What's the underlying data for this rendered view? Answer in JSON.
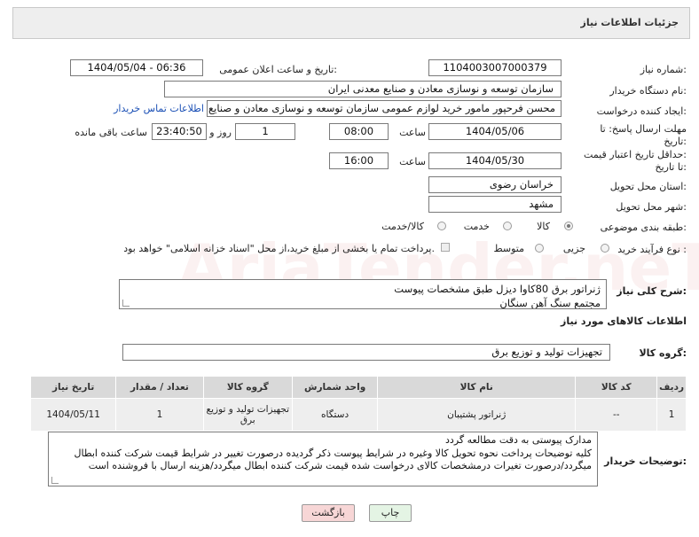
{
  "header": {
    "title": "جزئیات اطلاعات نیاز"
  },
  "watermark": "AriaTender.neT",
  "form": {
    "need_number_label": "شماره نیاز:",
    "need_number": "1104003007000379",
    "announce_label": "تاریخ و ساعت اعلان عمومی:",
    "announce_value": "1404/05/04 - 06:36",
    "buyer_org_label": "نام دستگاه خریدار:",
    "buyer_org": "سازمان توسعه و نوسازی معادن و صنایع معدنی ایران",
    "creator_label": "ایجاد کننده درخواست:",
    "creator": "محسن فرحپور مامور خرید لوازم عمومی سازمان توسعه و نوسازی معادن و صنایع معدنی ایران",
    "contact_link": "اطلاعات تماس خریدار",
    "deadline_label_1": "مهلت ارسال پاسخ: تا",
    "deadline_label_2": "تاریخ:",
    "deadline_date": "1404/05/06",
    "time_label": "ساعت",
    "deadline_time": "08:00",
    "days_value": "1",
    "days_label": "روز و",
    "remaining_time": "23:40:50",
    "remaining_label": "ساعت باقی مانده",
    "price_validity_label_1": "حداقل تاریخ اعتبار قیمت:",
    "price_validity_label_2": "تا تاریخ:",
    "price_validity_date": "1404/05/30",
    "price_validity_time": "16:00",
    "province_label": "استان محل تحویل:",
    "province": "خراسان رضوی",
    "city_label": "شهر محل تحویل:",
    "city": "مشهد",
    "category_label": "طبقه بندی موضوعی:",
    "category_options": [
      "کالا",
      "خدمت",
      "کالا/خدمت"
    ],
    "purchase_type_label": "نوع فرآیند خرید :",
    "purchase_options": [
      "جزیی",
      "متوسط"
    ],
    "payment_note": "پرداخت تمام یا بخشی از مبلغ خرید،از محل \"اسناد خزانه اسلامی\" خواهد بود."
  },
  "description": {
    "label": "شرح کلی نیاز:",
    "line1": "ژنراتور برق 80کاوا دیزل طبق مشخصات پیوست",
    "line2": "مجتمع سنگ آهن سنگان"
  },
  "goods_section": {
    "title": "اطلاعات کالاهای مورد نیاز",
    "group_label": "گروه کالا:",
    "group_value": "تجهیزات تولید و توزیع برق"
  },
  "table": {
    "headers": [
      "ردیف",
      "کد کالا",
      "نام کالا",
      "واحد شمارش",
      "گروه کالا",
      "تعداد / مقدار",
      "تاریخ نیاز"
    ],
    "rows": [
      [
        "1",
        "--",
        "ژنراتور پشتیبان",
        "دستگاه",
        "تجهیزات تولید و توزیع برق",
        "1",
        "1404/05/11"
      ]
    ]
  },
  "buyer_notes": {
    "label": "توضیحات خریدار:",
    "line1": "مدارک پیوستی به دقت مطالعه گردد",
    "line2": "کلیه توضیحات پرداخت نحوه تحویل کالا وغیره در شرایط پیوست ذکر گردیده درصورت تغییر در شرایط  قیمت شرکت کننده ابطال",
    "line3": "میگردد/درصورت تغیرات درمشخصات کالای درخواست شده قیمت شرکت کننده ابطال میگردد/هزینه ارسال با فروشنده است"
  },
  "buttons": {
    "print": "چاپ",
    "back": "بازگشت"
  },
  "colors": {
    "link": "#1a4fb5",
    "back_button_bg": "#f7d6d6",
    "print_button_bg": "#e4f4e4",
    "header_bg": "#eeeeee"
  }
}
